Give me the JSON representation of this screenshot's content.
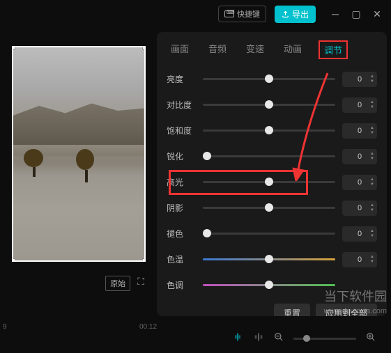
{
  "topbar": {
    "shortcut_label": "快捷键",
    "export_label": "导出"
  },
  "tabs": {
    "t1": "画面",
    "t2": "音频",
    "t3": "变速",
    "t4": "动画",
    "t5": "调节"
  },
  "sliders": [
    {
      "label": "亮度",
      "value": "0",
      "thumb_pct": 50,
      "gradient": ""
    },
    {
      "label": "对比度",
      "value": "0",
      "thumb_pct": 50,
      "gradient": ""
    },
    {
      "label": "饱和度",
      "value": "0",
      "thumb_pct": 50,
      "gradient": ""
    },
    {
      "label": "锐化",
      "value": "0",
      "thumb_pct": 3,
      "gradient": ""
    },
    {
      "label": "高光",
      "value": "0",
      "thumb_pct": 50,
      "gradient": ""
    },
    {
      "label": "阴影",
      "value": "0",
      "thumb_pct": 50,
      "gradient": ""
    },
    {
      "label": "褪色",
      "value": "0",
      "thumb_pct": 3,
      "gradient": ""
    },
    {
      "label": "色温",
      "value": "0",
      "thumb_pct": 50,
      "gradient": "gradient-temp"
    },
    {
      "label": "色调",
      "value": "",
      "thumb_pct": 50,
      "gradient": "gradient-tint"
    }
  ],
  "preview": {
    "original_label": "原始"
  },
  "footer": {
    "reset": "重置",
    "apply_all": "应用到全部"
  },
  "timeline": {
    "tick1": "9",
    "tick2": "00:12"
  },
  "watermark": {
    "cn": "当下软件园",
    "url": "www.downxia.com"
  }
}
